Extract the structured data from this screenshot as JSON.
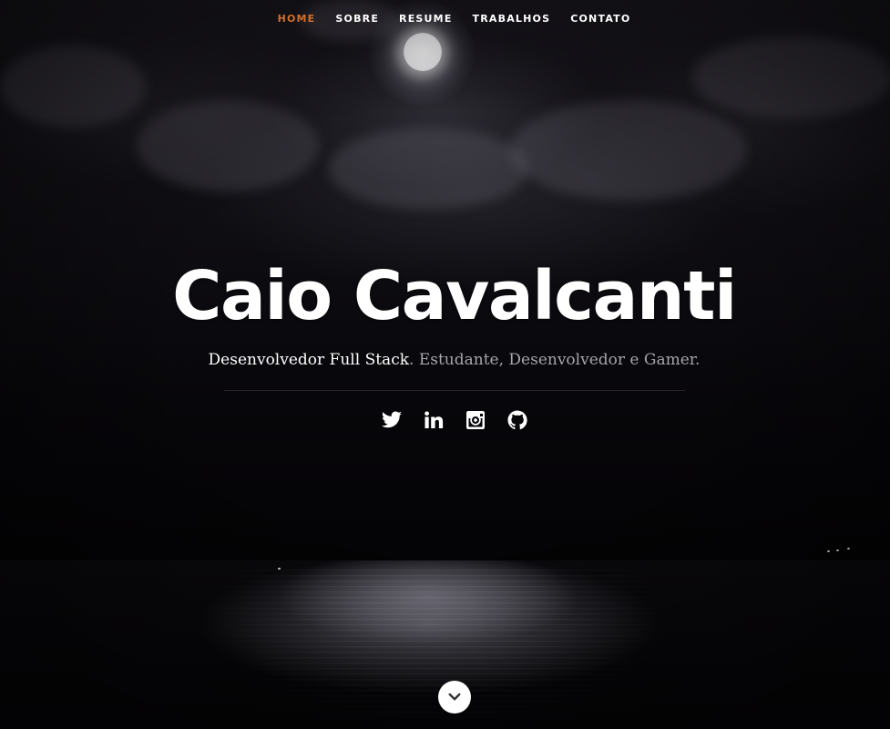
{
  "nav": {
    "items": [
      {
        "label": "HOME",
        "active": true
      },
      {
        "label": "SOBRE",
        "active": false
      },
      {
        "label": "RESUME",
        "active": false
      },
      {
        "label": "TRABALHOS",
        "active": false
      },
      {
        "label": "CONTATO",
        "active": false
      }
    ]
  },
  "banner": {
    "title": "Caio Cavalcanti",
    "subtitle_strong": "Desenvolvedor Full Stack",
    "subtitle_rest": ". Estudante, Desenvolvedor e Gamer."
  },
  "social": [
    {
      "icon": "twitter-icon"
    },
    {
      "icon": "linkedin-icon"
    },
    {
      "icon": "instagram-icon"
    },
    {
      "icon": "github-icon"
    }
  ],
  "scroll_down": {
    "icon": "chevron-down-icon"
  },
  "colors": {
    "accent": "#d16f2a",
    "text": "#ffffff",
    "subtitle_muted": "#a7a5ad"
  }
}
